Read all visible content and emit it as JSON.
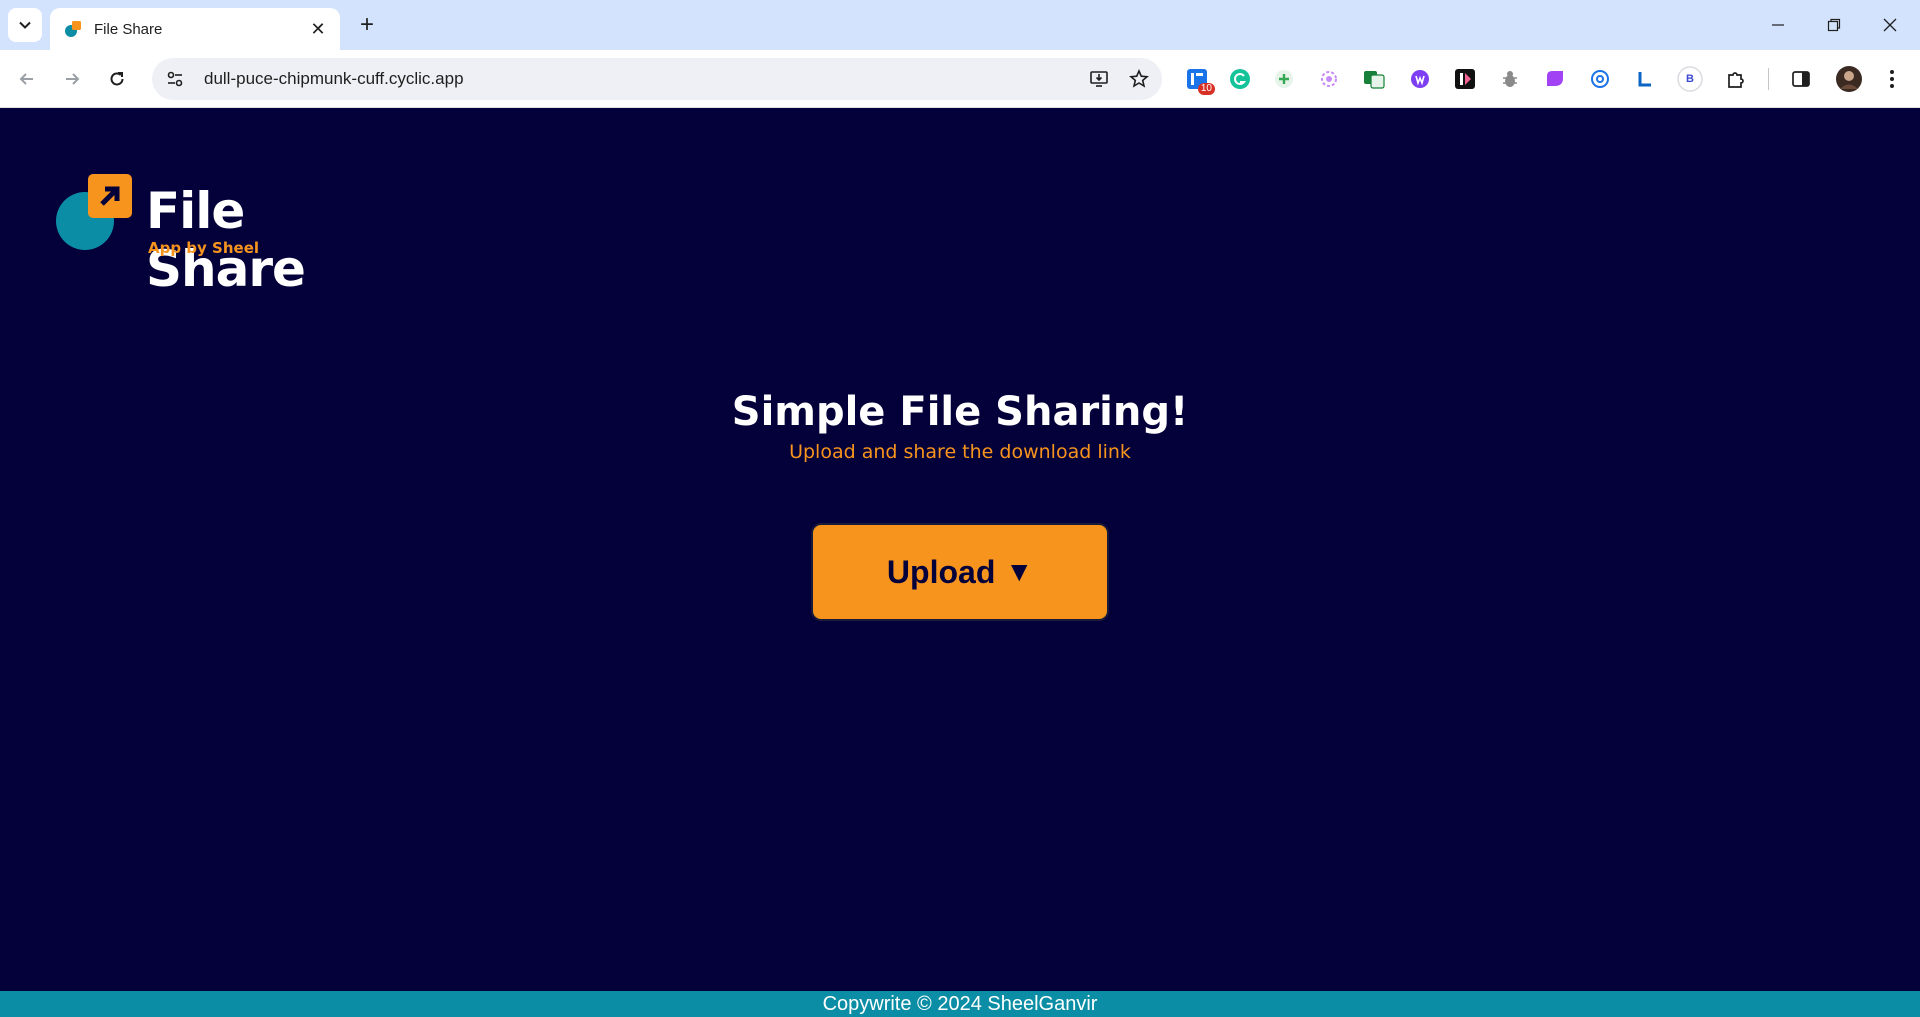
{
  "browser": {
    "tab": {
      "title": "File Share",
      "close_glyph": "✕"
    },
    "new_tab_glyph": "+",
    "address": {
      "url": "dull-puce-chipmunk-cuff.cyclic.app"
    },
    "extensions": [
      {
        "name": "extension-badge-icon",
        "badge": "10",
        "color": "#1a73e8"
      },
      {
        "name": "grammarly-icon",
        "color": "#15c39a"
      },
      {
        "name": "plus-extension-icon",
        "color": "#34a853"
      },
      {
        "name": "swirl-extension-icon",
        "color": "#c58af9"
      },
      {
        "name": "translate-extension-icon",
        "color": "#188038"
      },
      {
        "name": "purple-circle-extension-icon",
        "color": "#7e3ff2"
      },
      {
        "name": "dark-square-extension-icon",
        "color": "#111111"
      },
      {
        "name": "bug-extension-icon",
        "color": "#8a8a8a"
      },
      {
        "name": "gradient-extension-icon",
        "color": "#a142f4"
      },
      {
        "name": "at-sign-extension-icon",
        "color": "#1a73e8"
      },
      {
        "name": "l-extension-icon",
        "color": "#0a66c2"
      },
      {
        "name": "b-circle-extension-icon",
        "label": "B",
        "color": "#3c4ad1"
      }
    ]
  },
  "page": {
    "logo": {
      "title": "File Share",
      "subtitle": "App by Sheel"
    },
    "hero": {
      "title": "Simple File Sharing!",
      "subtitle": "Upload and share the download link"
    },
    "upload_button": {
      "label": "Upload",
      "caret": "▼"
    },
    "footer": {
      "text": "Copywrite © 2024 SheelGanvir"
    }
  },
  "colors": {
    "background": "#04003a",
    "accent": "#f7941d",
    "teal": "#0b8ea5"
  }
}
